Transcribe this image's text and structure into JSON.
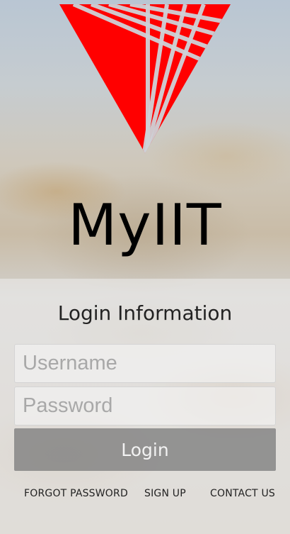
{
  "app": {
    "title": "MyIIT",
    "brand_color": "#ff0000"
  },
  "logo": {
    "icon": "red-triangle-stripes-logo"
  },
  "login": {
    "heading": "Login Information",
    "username_placeholder": "Username",
    "password_placeholder": "Password",
    "button_label": "Login"
  },
  "footer": {
    "forgot_password": "FORGOT PASSWORD",
    "sign_up": "SIGN UP",
    "contact_us": "CONTACT US"
  }
}
